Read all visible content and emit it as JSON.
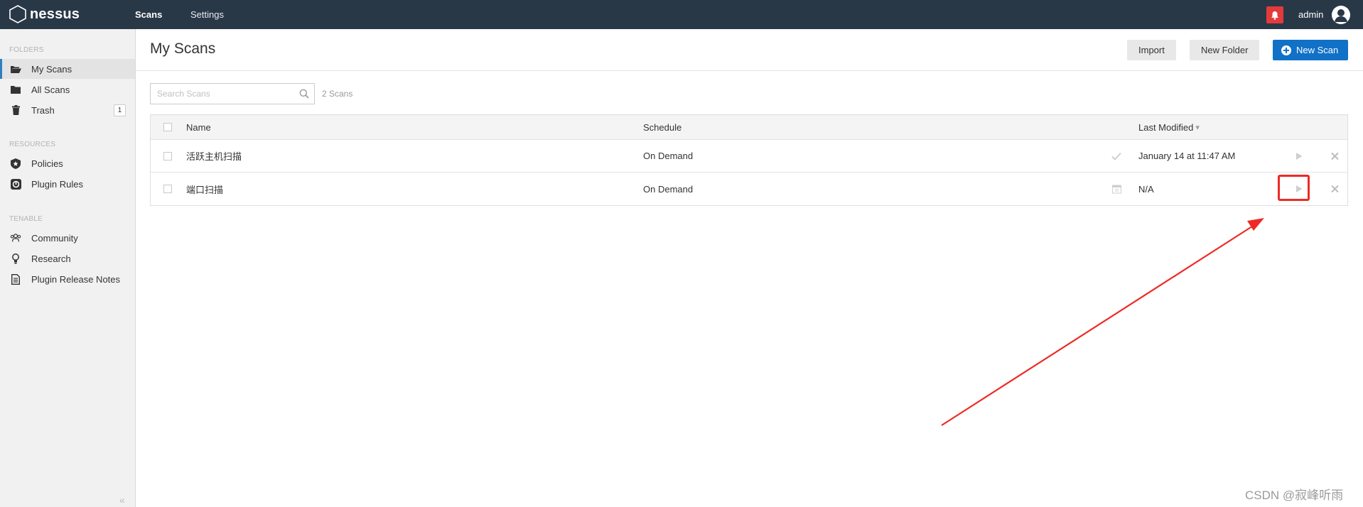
{
  "topbar": {
    "logo": "nessus",
    "nav": [
      "Scans",
      "Settings"
    ],
    "user": "admin"
  },
  "sidebar": {
    "sections": [
      {
        "title": "FOLDERS",
        "items": [
          {
            "label": "My Scans",
            "icon": "folder-open-icon",
            "active": true
          },
          {
            "label": "All Scans",
            "icon": "folder-icon"
          },
          {
            "label": "Trash",
            "icon": "trash-icon",
            "count": "1"
          }
        ]
      },
      {
        "title": "RESOURCES",
        "items": [
          {
            "label": "Policies",
            "icon": "policy-shield-icon"
          },
          {
            "label": "Plugin Rules",
            "icon": "plugin-rules-icon"
          }
        ]
      },
      {
        "title": "TENABLE",
        "items": [
          {
            "label": "Community",
            "icon": "community-icon"
          },
          {
            "label": "Research",
            "icon": "research-bulb-icon"
          },
          {
            "label": "Plugin Release Notes",
            "icon": "document-icon"
          }
        ]
      }
    ],
    "collapse_glyph": "«"
  },
  "main": {
    "title": "My Scans",
    "buttons": {
      "import": "Import",
      "new_folder": "New Folder",
      "new_scan": "New Scan"
    },
    "search": {
      "placeholder": "Search Scans"
    },
    "scan_count": "2 Scans",
    "table": {
      "columns": [
        "Name",
        "Schedule",
        "Last Modified"
      ],
      "sort_glyph": "▾",
      "rows": [
        {
          "name": "活跃主机扫描",
          "schedule": "On Demand",
          "status_icon": "check-icon",
          "last_modified": "January 14 at 11:47 AM"
        },
        {
          "name": "端口扫描",
          "schedule": "On Demand",
          "status_icon": "calendar-icon",
          "last_modified": "N/A"
        }
      ]
    }
  },
  "watermark": "CSDN @寂峰听雨",
  "colors": {
    "topbar": "#293847",
    "primary": "#1071c7",
    "alert": "#e33b3b",
    "annotation": "#ee2a24"
  }
}
